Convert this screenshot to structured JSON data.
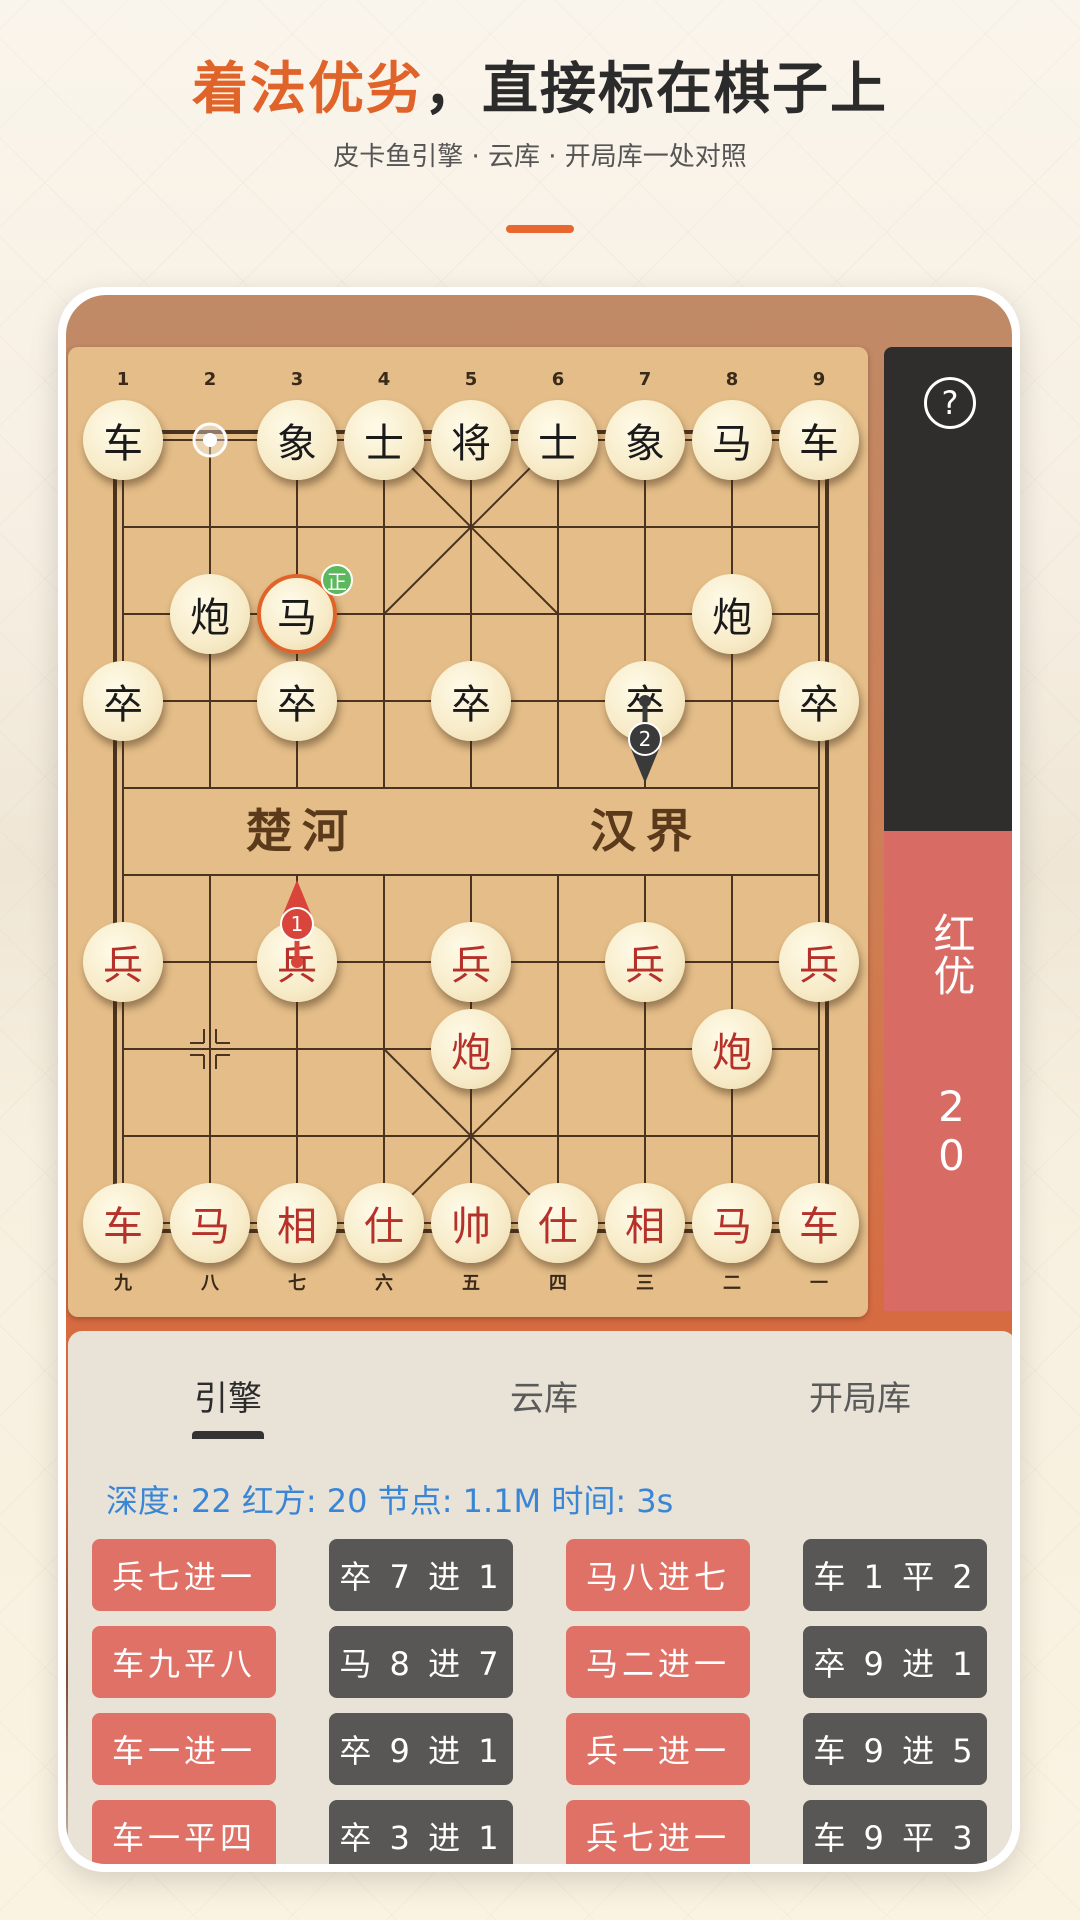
{
  "header": {
    "title_highlight": "着法优劣",
    "title_rest": "，直接标在棋子上",
    "subtitle": "皮卡鱼引擎 · 云库 · 开局库一处对照"
  },
  "board": {
    "top_numbers": [
      "1",
      "2",
      "3",
      "4",
      "5",
      "6",
      "7",
      "8",
      "9"
    ],
    "bottom_numbers": [
      "九",
      "八",
      "七",
      "六",
      "五",
      "四",
      "三",
      "二",
      "一"
    ],
    "river_left": "楚河",
    "river_right": "汉界",
    "pieces": [
      {
        "c": 0,
        "r": 0,
        "t": "车",
        "s": "black"
      },
      {
        "c": 2,
        "r": 0,
        "t": "象",
        "s": "black"
      },
      {
        "c": 3,
        "r": 0,
        "t": "士",
        "s": "black"
      },
      {
        "c": 4,
        "r": 0,
        "t": "将",
        "s": "black"
      },
      {
        "c": 5,
        "r": 0,
        "t": "士",
        "s": "black"
      },
      {
        "c": 6,
        "r": 0,
        "t": "象",
        "s": "black"
      },
      {
        "c": 7,
        "r": 0,
        "t": "马",
        "s": "black"
      },
      {
        "c": 8,
        "r": 0,
        "t": "车",
        "s": "black"
      },
      {
        "c": 1,
        "r": 2,
        "t": "炮",
        "s": "black"
      },
      {
        "c": 2,
        "r": 2,
        "t": "马",
        "s": "black",
        "selected": true
      },
      {
        "c": 7,
        "r": 2,
        "t": "炮",
        "s": "black"
      },
      {
        "c": 0,
        "r": 3,
        "t": "卒",
        "s": "black"
      },
      {
        "c": 2,
        "r": 3,
        "t": "卒",
        "s": "black"
      },
      {
        "c": 4,
        "r": 3,
        "t": "卒",
        "s": "black"
      },
      {
        "c": 6,
        "r": 3,
        "t": "卒",
        "s": "black"
      },
      {
        "c": 8,
        "r": 3,
        "t": "卒",
        "s": "black"
      },
      {
        "c": 0,
        "r": 6,
        "t": "兵",
        "s": "red"
      },
      {
        "c": 2,
        "r": 6,
        "t": "兵",
        "s": "red"
      },
      {
        "c": 4,
        "r": 6,
        "t": "兵",
        "s": "red"
      },
      {
        "c": 6,
        "r": 6,
        "t": "兵",
        "s": "red"
      },
      {
        "c": 8,
        "r": 6,
        "t": "兵",
        "s": "red"
      },
      {
        "c": 4,
        "r": 7,
        "t": "炮",
        "s": "red"
      },
      {
        "c": 7,
        "r": 7,
        "t": "炮",
        "s": "red"
      },
      {
        "c": 0,
        "r": 9,
        "t": "车",
        "s": "red"
      },
      {
        "c": 1,
        "r": 9,
        "t": "马",
        "s": "red"
      },
      {
        "c": 2,
        "r": 9,
        "t": "相",
        "s": "red"
      },
      {
        "c": 3,
        "r": 9,
        "t": "仕",
        "s": "red"
      },
      {
        "c": 4,
        "r": 9,
        "t": "帅",
        "s": "red"
      },
      {
        "c": 5,
        "r": 9,
        "t": "仕",
        "s": "red"
      },
      {
        "c": 6,
        "r": 9,
        "t": "相",
        "s": "red"
      },
      {
        "c": 7,
        "r": 9,
        "t": "马",
        "s": "red"
      },
      {
        "c": 8,
        "r": 9,
        "t": "车",
        "s": "red"
      }
    ],
    "badge": "正",
    "arrow1_label": "1",
    "arrow2_label": "2",
    "colors": {
      "arrow1": "#d9453a",
      "arrow2": "#3a3a3a",
      "badge": "#5cb85c",
      "selected": "#e0642a"
    }
  },
  "side": {
    "help": "?",
    "eval_label": "红优",
    "eval_score": "20"
  },
  "panel": {
    "tabs": [
      "引擎",
      "云库",
      "开局库"
    ],
    "stats": "深度: 22 红方: 20 节点: 1.1M 时间: 3s",
    "moves": [
      [
        "兵七进一",
        "卒 7 进 1",
        "马八进七",
        "车 1 平 2"
      ],
      [
        "车九平八",
        "马 8 进 7",
        "马二进一",
        "卒 9 进 1"
      ],
      [
        "车一进一",
        "卒 9 进 1",
        "兵一进一",
        "车 9 进 5"
      ],
      [
        "车一平四",
        "卒 3 进 1",
        "兵七进一",
        "车 9 平 3"
      ]
    ]
  }
}
